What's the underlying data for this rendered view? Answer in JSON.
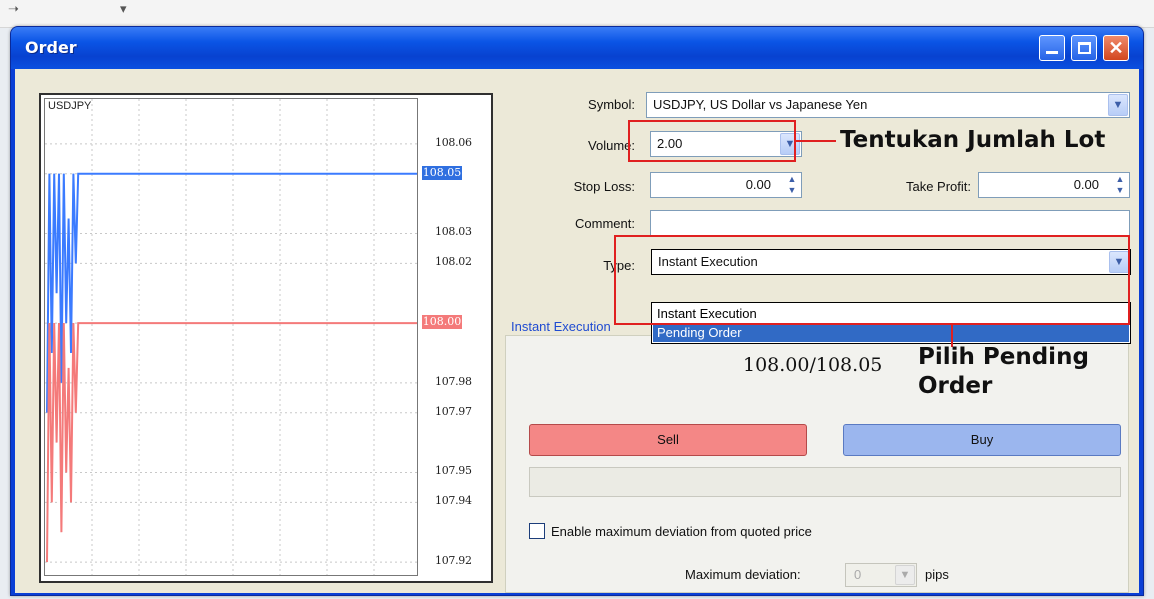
{
  "window": {
    "title": "Order"
  },
  "chart": {
    "symbol": "USDJPY",
    "price_ticks": [
      "108.06",
      "108.05",
      "108.03",
      "108.02",
      "108.00",
      "107.98",
      "107.97",
      "107.95",
      "107.94",
      "107.92"
    ],
    "ask_marker": "108.05",
    "bid_marker": "108.00",
    "ask_color": "#3b7bff",
    "bid_color": "#f47a7a"
  },
  "form": {
    "symbol_label": "Symbol:",
    "symbol_value": "USDJPY, US Dollar vs Japanese Yen",
    "volume_label": "Volume:",
    "volume_value": "2.00",
    "stop_loss_label": "Stop Loss:",
    "stop_loss_value": "0.00",
    "take_profit_label": "Take Profit:",
    "take_profit_value": "0.00",
    "comment_label": "Comment:",
    "comment_value": "",
    "type_label": "Type:",
    "type_value": "Instant Execution",
    "type_options": [
      "Instant Execution",
      "Pending Order"
    ],
    "type_selected_option": "Pending Order",
    "group_label": "Instant Execution",
    "quote": "108.00/108.05",
    "sell_label": "Sell",
    "buy_label": "Buy",
    "deviation_checkbox_label": "Enable maximum deviation from quoted price",
    "deviation_checked": false,
    "max_deviation_label": "Maximum deviation:",
    "max_deviation_value": "0",
    "pips_label": "pips"
  },
  "annotations": {
    "lot_text": "Tentukan Jumlah Lot",
    "pending_line1": "Pilih Pending",
    "pending_line2": "Order",
    "color": "#e02020"
  }
}
